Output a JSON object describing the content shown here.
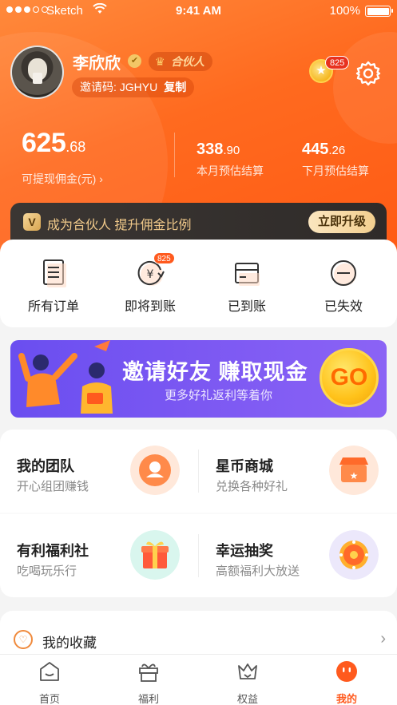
{
  "status_bar": {
    "carrier": "Sketch",
    "time": "9:41 AM",
    "battery": "100%"
  },
  "profile": {
    "name": "李欣欣",
    "badge": "合伙人",
    "invite_label": "邀请码: JGHYU",
    "copy_label": "复制",
    "coin_count": "825"
  },
  "earnings": {
    "withdrawable_int": "625",
    "withdrawable_dec": ".68",
    "withdrawable_label": "可提现佣金(元) ›",
    "this_month_int": "338",
    "this_month_dec": ".90",
    "this_month_label": "本月预估结算",
    "next_month_int": "445",
    "next_month_dec": ".26",
    "next_month_label": "下月预估结算"
  },
  "vip": {
    "icon_letter": "V",
    "text": "成为合伙人 提升佣金比例",
    "button": "立即升级"
  },
  "orders": {
    "items": [
      {
        "label": "所有订单",
        "icon": "document-icon"
      },
      {
        "label": "即将到账",
        "icon": "yen-clock-icon",
        "badge": "825"
      },
      {
        "label": "已到账",
        "icon": "card-icon"
      },
      {
        "label": "已失效",
        "icon": "minus-circle-icon"
      }
    ]
  },
  "banner": {
    "title": "邀请好友 赚取现金",
    "subtitle": "更多好礼返利等着你",
    "go": "GO"
  },
  "services": [
    {
      "title": "我的团队",
      "subtitle": "开心组团赚钱",
      "color": "#ffe8da"
    },
    {
      "title": "星币商城",
      "subtitle": "兑换各种好礼",
      "color": "#ffe8da"
    },
    {
      "title": "有利福利社",
      "subtitle": "吃喝玩乐行",
      "color": "#d9f6ee"
    },
    {
      "title": "幸运抽奖",
      "subtitle": "高额福利大放送",
      "color": "#ece8fb"
    }
  ],
  "favorites": {
    "label": "我的收藏"
  },
  "tabs": [
    {
      "label": "首页",
      "icon": "home-icon"
    },
    {
      "label": "福利",
      "icon": "gift-box-icon"
    },
    {
      "label": "权益",
      "icon": "crown-icon"
    },
    {
      "label": "我的",
      "icon": "profile-face-icon",
      "active": true
    }
  ],
  "colors": {
    "brand_orange": "#ff5a1e",
    "vip_dark": "#2f2b29",
    "banner_purple": "#7a57f2"
  }
}
